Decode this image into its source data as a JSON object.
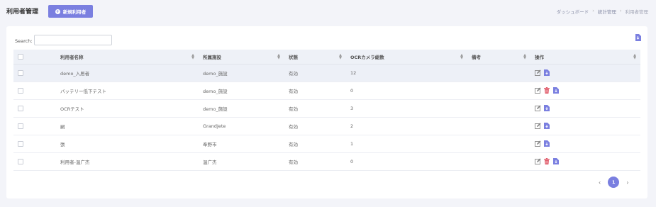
{
  "header": {
    "title": "利用者管理",
    "add_button_label": "新規利用者",
    "breadcrumb": [
      "ダッシュボード",
      "統計管理",
      "利用者管理"
    ]
  },
  "search": {
    "label": "Search:",
    "value": "",
    "placeholder": ""
  },
  "table": {
    "columns": [
      "利用者名称",
      "所属施設",
      "状態",
      "OCRカメラ総数",
      "備考",
      "操作"
    ],
    "rows": [
      {
        "name": "demo_入居者",
        "facility": "demo_施設",
        "status": "有効",
        "cameras": "12",
        "note": "",
        "delete": false
      },
      {
        "name": "バッテリー低下テスト",
        "facility": "demo_施設",
        "status": "有効",
        "cameras": "0",
        "note": "",
        "delete": true
      },
      {
        "name": "OCRテスト",
        "facility": "demo_施設",
        "status": "有効",
        "cameras": "3",
        "note": "",
        "delete": false
      },
      {
        "name": "嗣",
        "facility": "GrandJete",
        "status": "有効",
        "cameras": "2",
        "note": "",
        "delete": false
      },
      {
        "name": "張",
        "facility": "奉野市",
        "status": "有効",
        "cameras": "1",
        "note": "",
        "delete": false
      },
      {
        "name": "利用者-温广杰",
        "facility": "温广杰",
        "status": "有効",
        "cameras": "0",
        "note": "",
        "delete": true
      }
    ]
  },
  "pagination": {
    "prev": "‹",
    "current": "1",
    "next": "›"
  },
  "colors": {
    "accent": "#7a7fe0",
    "delete": "#e05a6a",
    "edit": "#888888"
  }
}
